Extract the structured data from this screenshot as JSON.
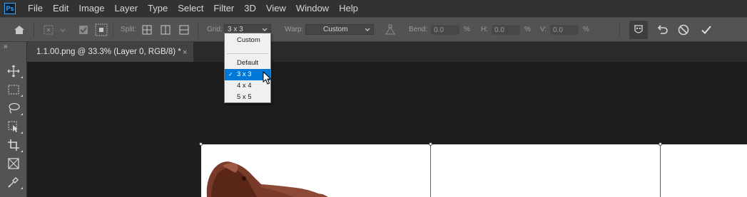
{
  "app": {
    "logo_text": "Ps"
  },
  "menu": [
    "File",
    "Edit",
    "Image",
    "Layer",
    "Type",
    "Select",
    "Filter",
    "3D",
    "View",
    "Window",
    "Help"
  ],
  "options_bar": {
    "split_label": "Split:",
    "grid_label": "Grid:",
    "grid_value": "3 x 3",
    "warp_label": "Warp:",
    "warp_value": "Custom",
    "bend_label": "Bend:",
    "bend_value": "0.0",
    "h_label": "H:",
    "h_value": "0.0",
    "v_label": "V:",
    "v_value": "0.0",
    "percent": "%"
  },
  "grid_dropdown": {
    "options": [
      {
        "label": "Custom",
        "checked": false,
        "highlighted": false
      },
      {
        "label": "Default",
        "checked": false,
        "highlighted": false
      },
      {
        "label": "3 x 3",
        "checked": true,
        "highlighted": true
      },
      {
        "label": "4 x 4",
        "checked": false,
        "highlighted": false
      },
      {
        "label": "5 x 5",
        "checked": false,
        "highlighted": false
      }
    ],
    "check_mark": "✓"
  },
  "document_tab": {
    "title": "1.1.00.png @ 33.3% (Layer 0, RGB/8) *",
    "close_glyph": "×"
  },
  "colors": {
    "accent": "#31a8ff",
    "highlight": "#0078d7",
    "panel": "#535353",
    "canvas_bg": "#1e1e1e"
  },
  "icons": {
    "menubar": [
      "photoshop-logo"
    ],
    "options_bar": [
      "home-icon",
      "warp-transform-icon",
      "checkbox-icon",
      "grid-points-icon",
      "split-cross-icon",
      "split-vertical-icon",
      "split-horizontal-icon",
      "warp-anchor-icon",
      "toggle-perspective-icon",
      "undo-icon",
      "cancel-icon",
      "commit-icon"
    ],
    "toolbar": [
      "move-icon",
      "marquee-icon",
      "lasso-icon",
      "object-select-icon",
      "crop-icon",
      "frame-icon",
      "eyedropper-icon"
    ]
  }
}
